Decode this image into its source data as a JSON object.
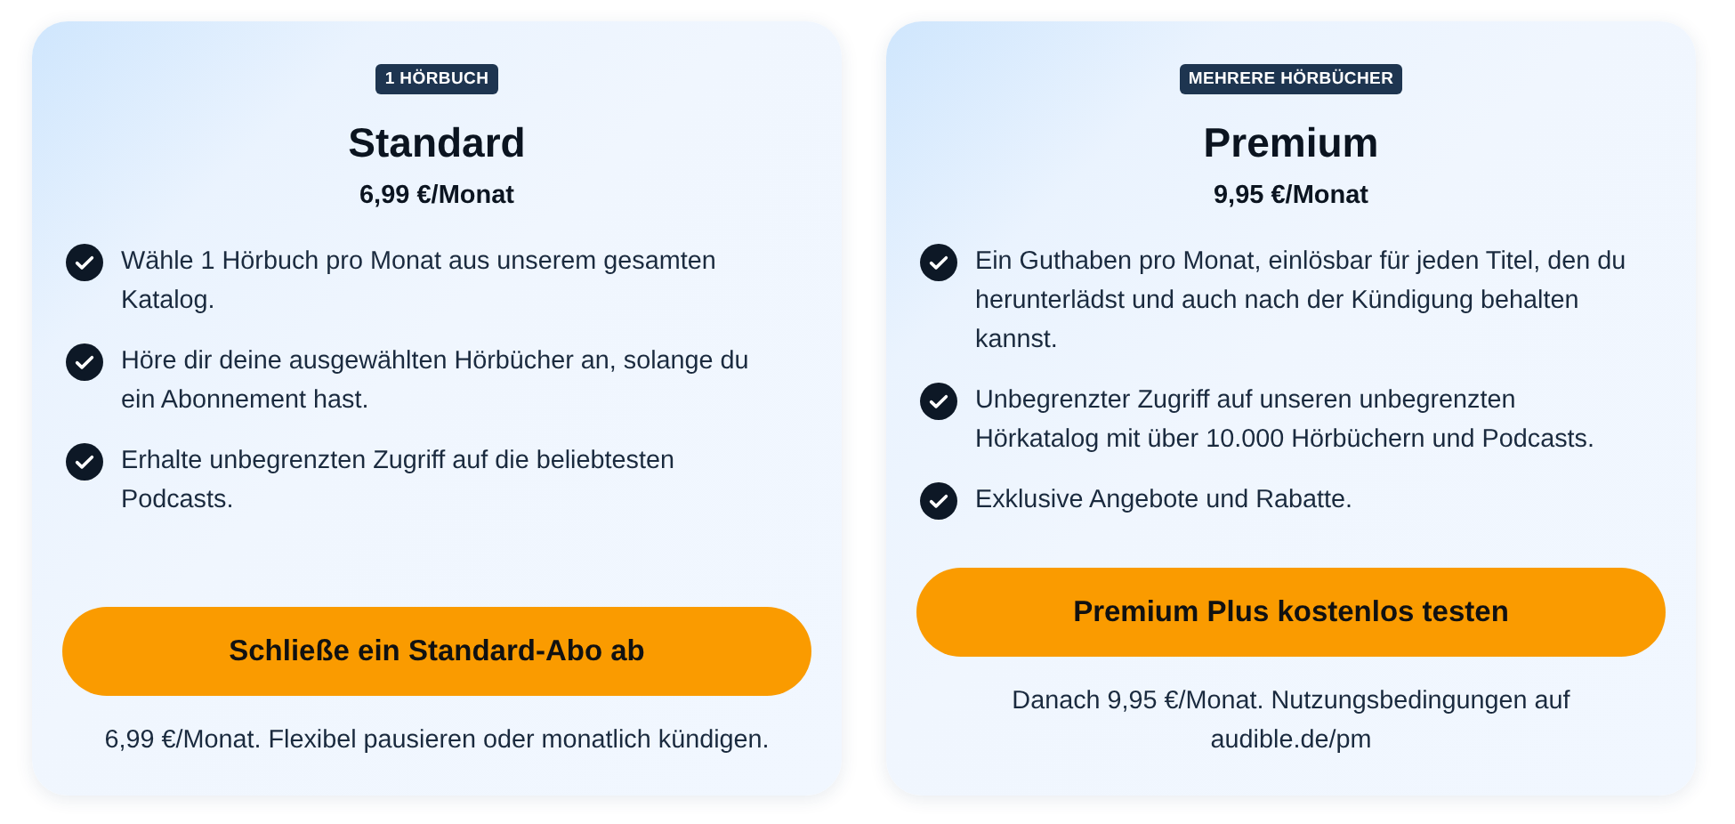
{
  "plans": [
    {
      "badge": "1 HÖRBUCH",
      "title": "Standard",
      "price": "6,99 €/Monat",
      "features": [
        "Wähle 1 Hörbuch pro Monat aus unserem gesamten Katalog.",
        "Höre dir deine ausgewählten Hörbücher an, solange du ein Abonnement hast.",
        "Erhalte unbegrenzten Zugriff auf die beliebtesten Podcasts."
      ],
      "button": "Schließe ein Standard-Abo ab",
      "note": "6,99 €/Monat. Flexibel pausieren oder monatlich kündigen."
    },
    {
      "badge": "MEHRERE HÖRBÜCHER",
      "title": "Premium",
      "price": "9,95 €/Monat",
      "features": [
        "Ein Guthaben pro Monat, einlösbar für jeden Titel, den du herunterlädst und auch nach der Kündigung behalten kannst.",
        "Unbegrenzter Zugriff auf unseren unbegrenzten Hörkatalog mit über 10.000 Hörbüchern und Podcasts.",
        "Exklusive Angebote und Rabatte."
      ],
      "button": "Premium Plus kostenlos testen",
      "note": "Danach 9,95 €/Monat. Nutzungsbedingungen auf audible.de/pm"
    }
  ]
}
